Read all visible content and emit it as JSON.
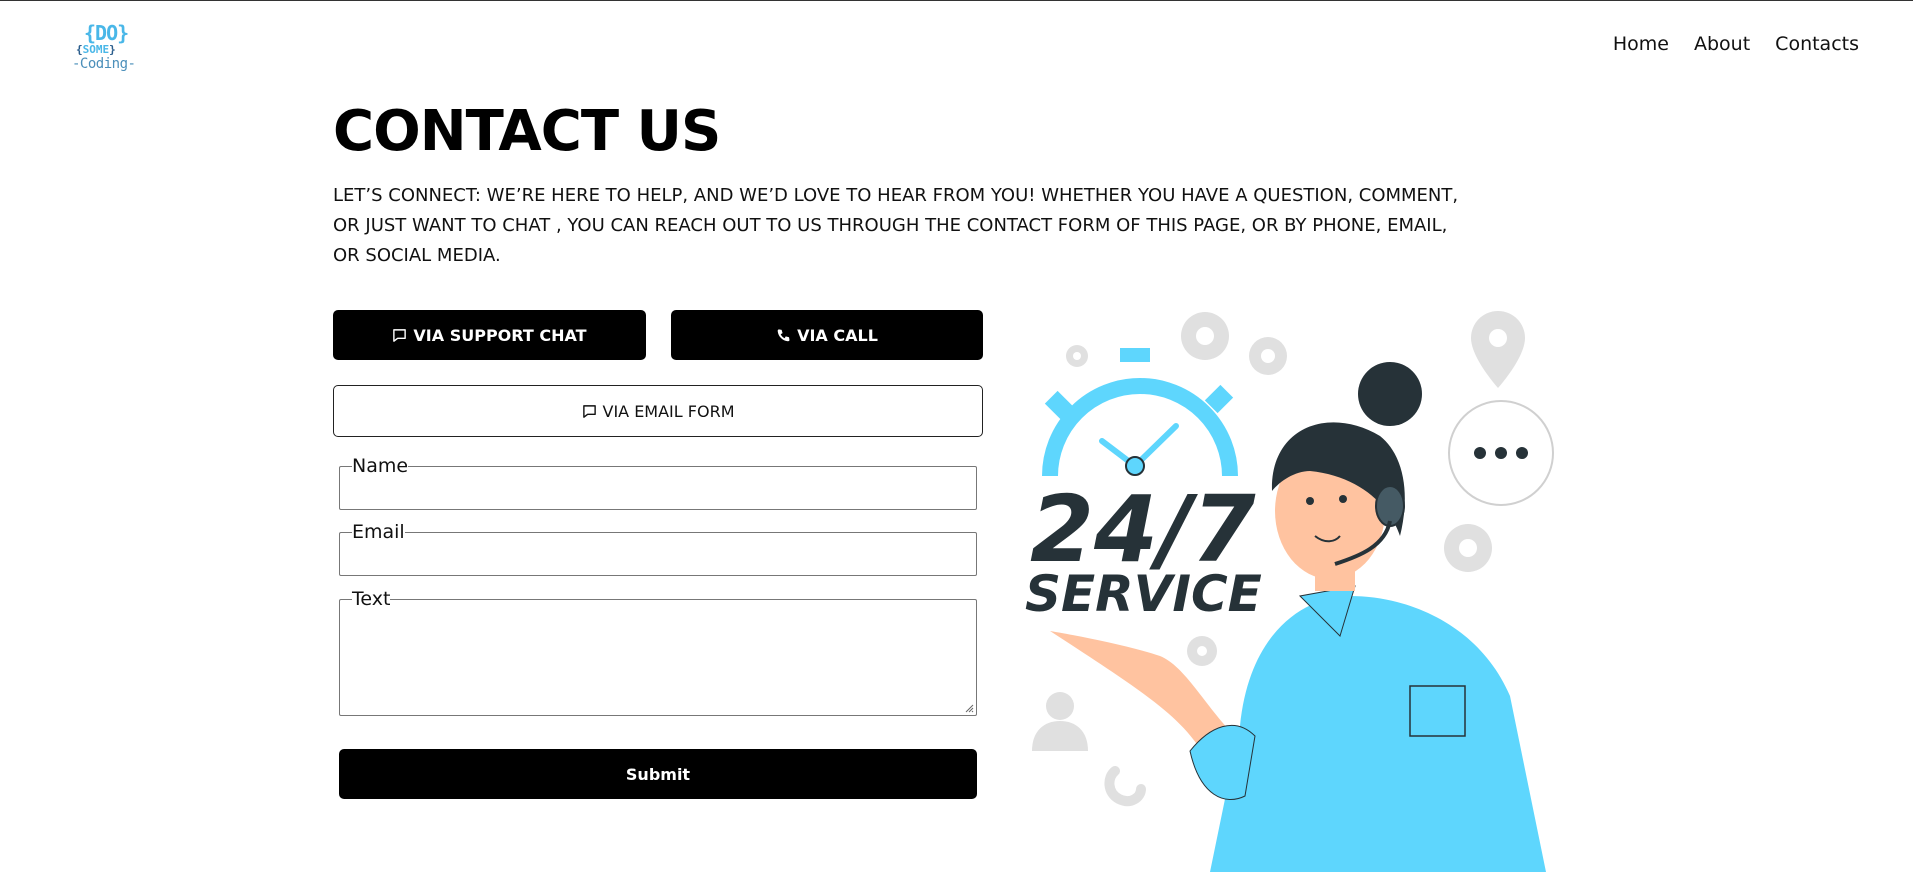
{
  "logo": {
    "line1_a": "{",
    "line1_b": "DO",
    "line1_c": "}",
    "line2_a": "{",
    "line2_b": "SOME",
    "line2_c": "}",
    "line3": "-Coding-"
  },
  "nav": {
    "items": [
      "Home",
      "About",
      "Contacts"
    ]
  },
  "page": {
    "title": "CONTACT US",
    "intro": "LET’S CONNECT: WE’RE HERE TO HELP, AND WE’D LOVE TO HEAR FROM YOU! WHETHER YOU HAVE A QUESTION, COMMENT, OR JUST WANT TO CHAT , YOU CAN REACH OUT TO US THROUGH THE CONTACT FORM OF THIS PAGE, OR BY PHONE, EMAIL, OR SOCIAL MEDIA."
  },
  "buttons": {
    "support_chat": {
      "label": "VIA SUPPORT CHAT",
      "icon": "chat-bubble-icon"
    },
    "call": {
      "label": "VIA CALL",
      "icon": "phone-icon"
    },
    "email_form": {
      "label": "VIA EMAIL FORM",
      "icon": "chat-bubble-icon"
    }
  },
  "form": {
    "name": {
      "legend": "Name",
      "value": ""
    },
    "email": {
      "legend": "Email",
      "value": ""
    },
    "text": {
      "legend": "Text",
      "value": ""
    },
    "submit_label": "Submit"
  },
  "illustration": {
    "headline": "24/7",
    "subline": "SERVICE",
    "colors": {
      "accent": "#5ed6fd",
      "dark": "#263238",
      "skin": "#ffc3a0",
      "icons": "#e0e0e0"
    }
  },
  "colors": {
    "primary_button": "#000000",
    "background": "#ffffff"
  }
}
